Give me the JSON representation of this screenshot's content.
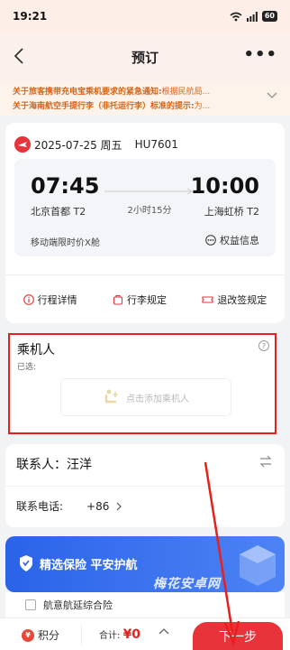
{
  "status": {
    "time": "19:21",
    "battery": "60"
  },
  "nav": {
    "title": "预订"
  },
  "notices": [
    {
      "title": "关于旅客携带充电宝乘机要求的紧急通知:",
      "text": "根据民航局..."
    },
    {
      "title": "关于海南航空手提行李（非托运行李）标准的提示:",
      "text": "为..."
    }
  ],
  "flight": {
    "date": "2025-07-25 周五",
    "flight_no": "HU7601",
    "dep_time": "07:45",
    "arr_time": "10:00",
    "dep_airport": "北京首都 T2",
    "arr_airport": "上海虹桥 T2",
    "duration": "2小时15分",
    "fare": "移动端限时价X舱",
    "rights": "权益信息",
    "links": [
      "行程详情",
      "行李规定",
      "退改签规定"
    ]
  },
  "passengers": {
    "title": "乘机人",
    "selected": "已选:",
    "add": "点击添加乘机人",
    "help": "?"
  },
  "contact": {
    "label": "联系人：汪洋",
    "phone_label": "联系电话:",
    "country_code": "+86"
  },
  "insurance": {
    "title": "精选保险 平安护航",
    "item": "航意航延综合险"
  },
  "watermark": "梅花安卓网",
  "bottom": {
    "points": "积分",
    "coin": "¥",
    "total_label": "合计:",
    "total_amount": "¥0",
    "next": "下一步"
  },
  "colors": {
    "accent": "#e8333a",
    "highlight_box": "#e8201c",
    "insurance_blue": "#2a63e8",
    "notice_text": "#d56518"
  }
}
